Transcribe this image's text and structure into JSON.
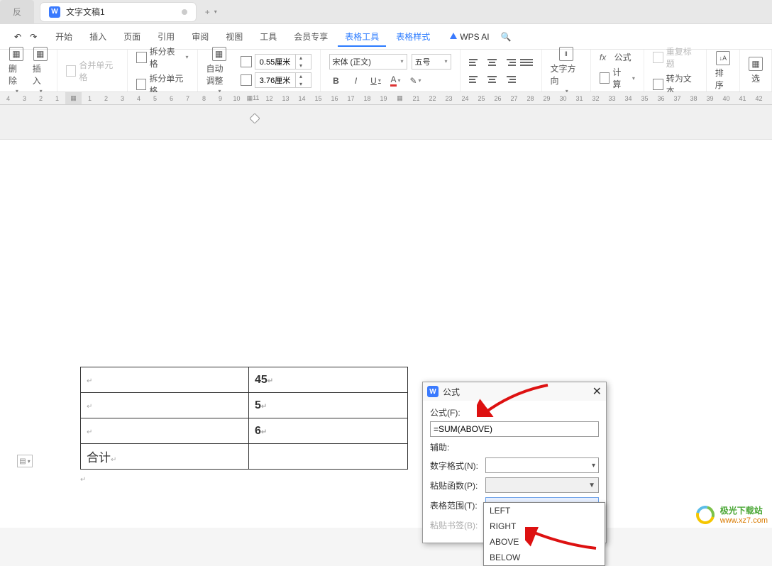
{
  "titlebar": {
    "app_tab": "反",
    "doc_name": "文字文稿1",
    "new_tab_plus": "+"
  },
  "menubar": {
    "undo": "↶",
    "redo": "↷",
    "items": [
      "开始",
      "插入",
      "页面",
      "引用",
      "审阅",
      "视图",
      "工具",
      "会员专享",
      "表格工具",
      "表格样式"
    ],
    "active_index": 8,
    "wps_ai": "WPS AI",
    "search_icon": "🔍"
  },
  "ribbon": {
    "delete": "删除",
    "insert": "插入",
    "merge_cells": "合并单元格",
    "split_table": "拆分表格",
    "split_cells": "拆分单元格",
    "auto_adjust": "自动调整",
    "row_height": "0.55厘米",
    "col_width": "3.76厘米",
    "font_name": "宋体 (正文)",
    "font_size": "五号",
    "bold": "B",
    "italic": "I",
    "underline": "U",
    "font_color": "A",
    "highlight": "✎",
    "text_direction": "文字方向",
    "fx_formula": "公式",
    "calc": "计算",
    "repeat_header": "重复标题",
    "to_text": "转为文本",
    "sort": "排序",
    "select": "选"
  },
  "table": {
    "rows": [
      {
        "c1": "",
        "c2": "45"
      },
      {
        "c1": "",
        "c2": "5"
      },
      {
        "c1": "",
        "c2": "6"
      },
      {
        "c1": "合计",
        "c2": ""
      }
    ]
  },
  "dialog": {
    "title": "公式",
    "formula_label": "公式(F):",
    "formula_value": "=SUM(ABOVE)",
    "assist_label": "辅助:",
    "number_format": "数字格式(N):",
    "paste_func": "粘贴函数(P):",
    "table_range": "表格范围(T):",
    "paste_bookmark": "粘贴书签(B):",
    "dropdown_items": [
      "LEFT",
      "RIGHT",
      "ABOVE",
      "BELOW"
    ]
  },
  "watermark": {
    "text": "极光下载站",
    "url": "www.xz7.com"
  }
}
